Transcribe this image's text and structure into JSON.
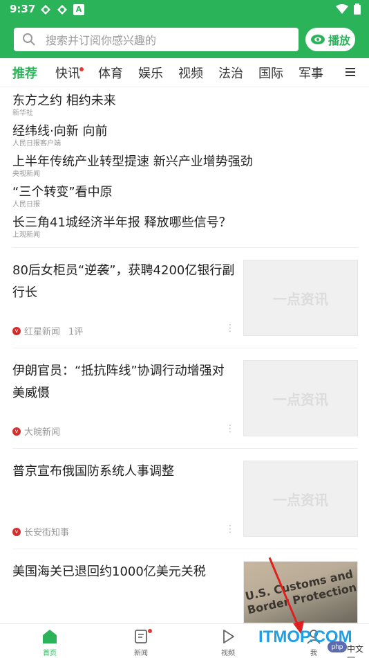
{
  "status": {
    "time": "9:37",
    "badge_a": "A"
  },
  "search": {
    "placeholder": "搜索并订阅你感兴趣的"
  },
  "play_button": {
    "label": "播放"
  },
  "tabs": [
    {
      "label": "推荐",
      "active": true
    },
    {
      "label": "快讯",
      "dot": true
    },
    {
      "label": "体育"
    },
    {
      "label": "娱乐"
    },
    {
      "label": "视频"
    },
    {
      "label": "法治"
    },
    {
      "label": "国际"
    },
    {
      "label": "军事"
    }
  ],
  "headlines": [
    {
      "title": "东方之约 相约未来",
      "source": "新华社"
    },
    {
      "title": "经纬线·向新 向前",
      "source": "人民日报客户端"
    },
    {
      "title": "上半年传统产业转型提速 新兴产业增势强劲",
      "source": "央视新闻"
    },
    {
      "title": "“三个转变”看中原",
      "source": "人民日报"
    },
    {
      "title": "长三角41城经济半年报 释放哪些信号？",
      "source": "上观新闻"
    }
  ],
  "articles": [
    {
      "title": "80后女柜员“逆袭”，获聘4200亿银行副行长",
      "source": "红星新闻",
      "comments": "1评",
      "thumb_text": "一点资讯"
    },
    {
      "title": "伊朗官员：“抵抗阵线”协调行动增强对美威慑",
      "source": "大皖新闻",
      "comments": "",
      "thumb_text": "一点资讯"
    },
    {
      "title": "普京宣布俄国防系统人事调整",
      "source": "长安街知事",
      "comments": "",
      "thumb_text": "一点资讯"
    },
    {
      "title": "美国海关已退回约1000亿美元关税",
      "source": "",
      "comments": "",
      "thumb_text": "U.S. Customs and Border Protection"
    }
  ],
  "bottom_nav": [
    {
      "label": "首页",
      "icon": "home-icon",
      "active": true
    },
    {
      "label": "新闻",
      "icon": "news-icon",
      "dot": true
    },
    {
      "label": "视频",
      "icon": "video-play-icon"
    },
    {
      "label": "我",
      "icon": "profile-icon"
    }
  ],
  "watermark": {
    "text": "ITMOP.COM",
    "php": "php",
    "cn": "中文网"
  },
  "colors": {
    "brand_green": "#2bb35a",
    "dot_red": "#e53935",
    "source_red": "#d32f2f",
    "watermark_blue": "#1fa0e6"
  }
}
